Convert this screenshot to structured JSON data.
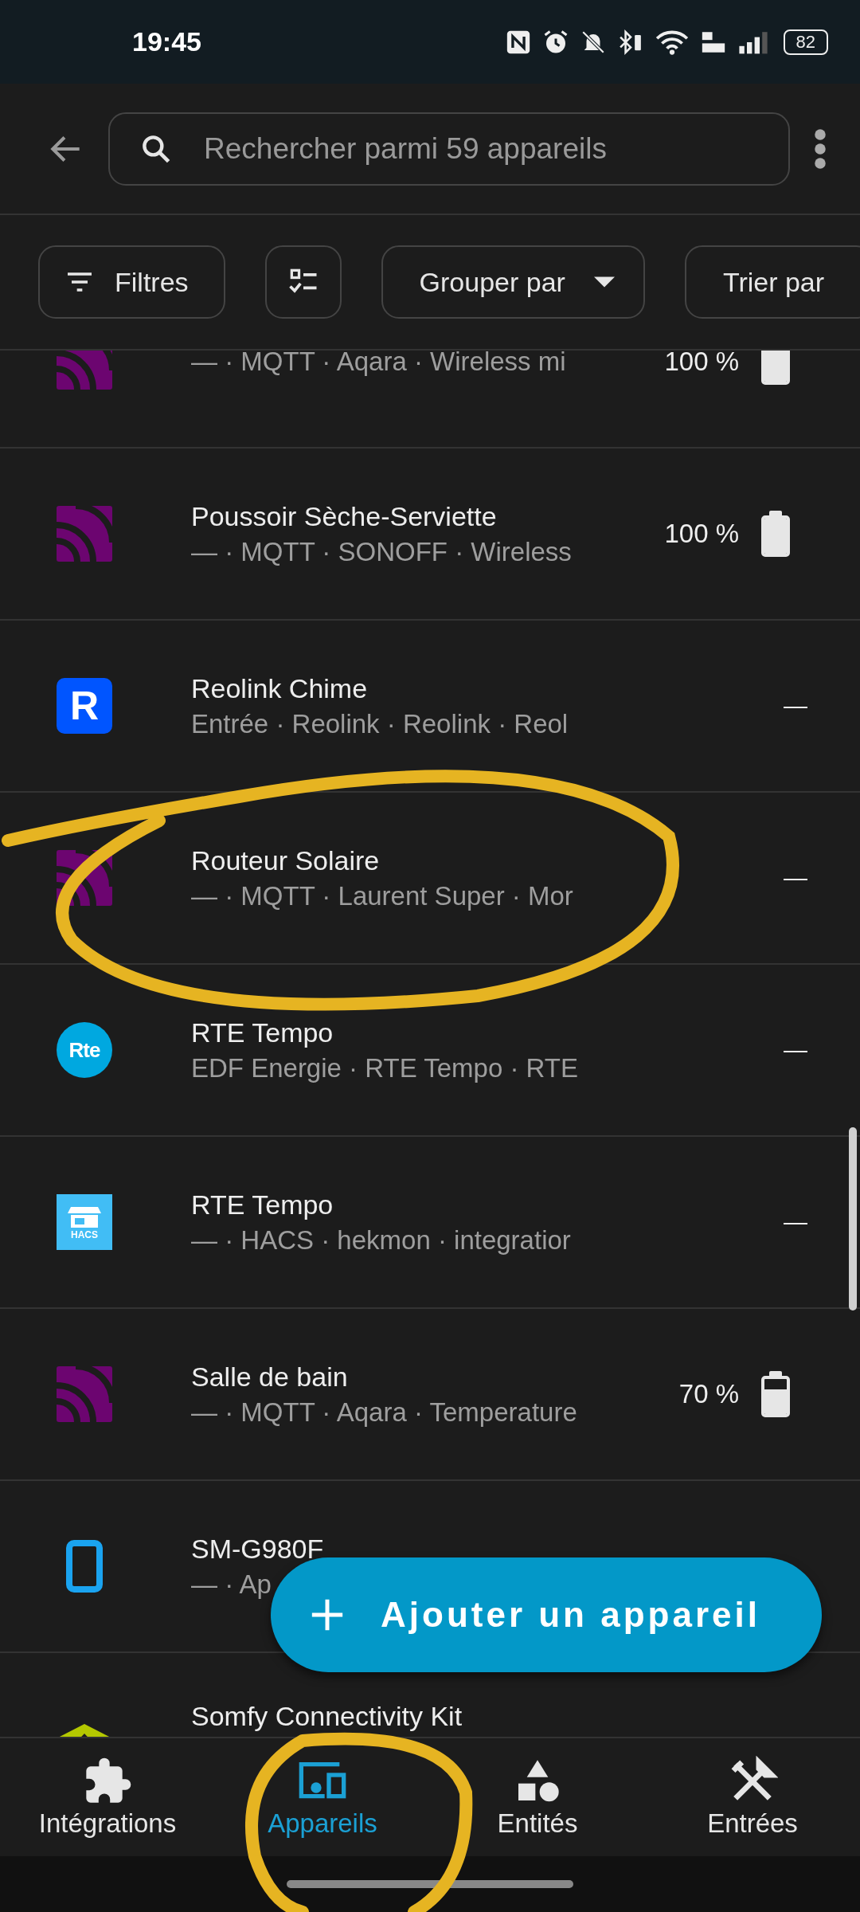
{
  "status_bar": {
    "time": "19:45",
    "battery": "82"
  },
  "app_bar": {
    "search": {
      "placeholder": "Rechercher parmi 59 appareils"
    }
  },
  "chips": [
    {
      "kind": "filter",
      "label": "Filtres"
    },
    {
      "kind": "select"
    },
    {
      "kind": "dropdown",
      "label": "Grouper par"
    },
    {
      "kind": "plain",
      "label": "Trier par"
    }
  ],
  "devices": [
    {
      "kind": "mqtt",
      "subtitle": "— · MQTT · Aqara · Wireless mi",
      "end": {
        "kind": "battery",
        "text": "100 %",
        "level": 1
      }
    },
    {
      "kind": "mqtt",
      "name": "Poussoir Sèche-Serviette",
      "subtitle": "— · MQTT · SONOFF · Wireless",
      "end": {
        "kind": "battery",
        "text": "100 %",
        "level": 1
      }
    },
    {
      "kind": "logo",
      "logo_text": "R",
      "name": "Reolink Chime",
      "subtitle": "Entrée · Reolink · Reolink · Reol",
      "end": {
        "kind": "dash",
        "text": "—"
      }
    },
    {
      "kind": "mqtt",
      "name": "Routeur Solaire",
      "subtitle": "— · MQTT · Laurent Super · Mor",
      "end": {
        "kind": "dash",
        "text": "—"
      }
    },
    {
      "kind": "round",
      "logo_text": "Rte",
      "name": "RTE Tempo",
      "subtitle": "EDF Energie · RTE Tempo · RTE",
      "end": {
        "kind": "dash",
        "text": "—"
      }
    },
    {
      "kind": "hacs",
      "logo_text": "HACS",
      "name": "RTE Tempo",
      "subtitle": "— · HACS · hekmon · integratior",
      "end": {
        "kind": "dash",
        "text": "—"
      }
    },
    {
      "kind": "mqtt",
      "name": "Salle de bain",
      "subtitle": "— · MQTT · Aqara · Temperature",
      "end": {
        "kind": "battery",
        "text": "70 %",
        "level": 0.7
      }
    },
    {
      "kind": "phone",
      "name": "SM-G980F",
      "subtitle": "— · Ap"
    },
    {
      "kind": "somfy",
      "name": "Somfy Connectivity Kit"
    }
  ],
  "fab": {
    "label": "Ajouter un appareil"
  },
  "nav": [
    {
      "kind": "puzzle",
      "label": "Intégrations",
      "selected": false
    },
    {
      "kind": "devices",
      "label": "Appareils",
      "selected": true
    },
    {
      "kind": "shapes",
      "label": "Entités",
      "selected": false
    },
    {
      "kind": "tools",
      "label": "Entrées",
      "selected": false
    }
  ]
}
